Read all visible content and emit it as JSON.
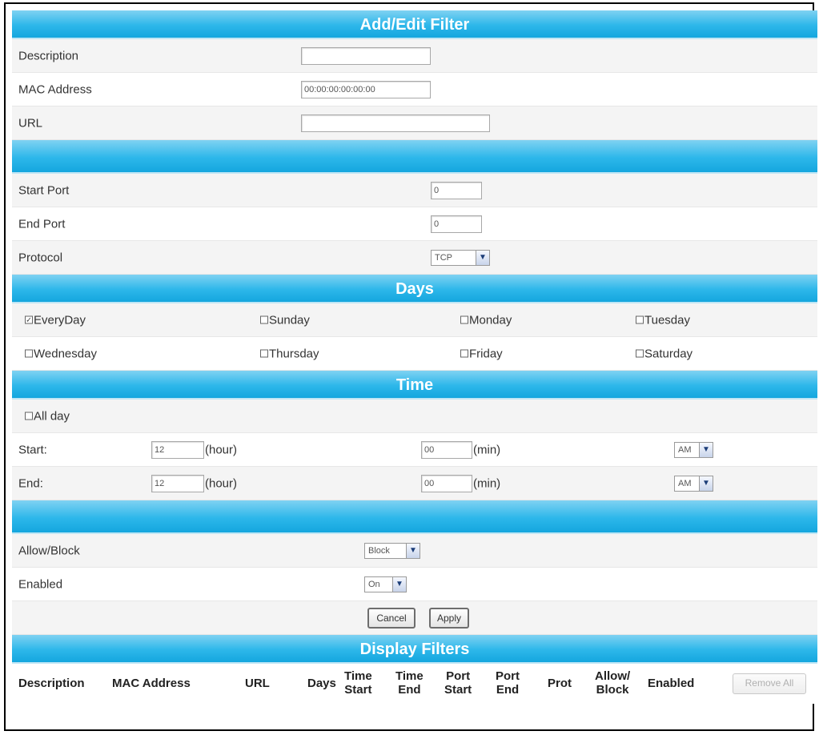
{
  "add_edit": {
    "title": "Add/Edit Filter",
    "description": {
      "label": "Description",
      "value": ""
    },
    "mac_address": {
      "label": "MAC Address",
      "value": "00:00:00:00:00:00"
    },
    "url": {
      "label": "URL",
      "value": ""
    },
    "start_port": {
      "label": "Start Port",
      "value": "0"
    },
    "end_port": {
      "label": "End Port",
      "value": "0"
    },
    "protocol": {
      "label": "Protocol",
      "value": "TCP"
    }
  },
  "days": {
    "title": "Days",
    "items": [
      {
        "label": "EveryDay",
        "checked": true
      },
      {
        "label": "Sunday",
        "checked": false
      },
      {
        "label": "Monday",
        "checked": false
      },
      {
        "label": "Tuesday",
        "checked": false
      },
      {
        "label": "Wednesday",
        "checked": false
      },
      {
        "label": "Thursday",
        "checked": false
      },
      {
        "label": "Friday",
        "checked": false
      },
      {
        "label": "Saturday",
        "checked": false
      }
    ]
  },
  "time": {
    "title": "Time",
    "all_day": {
      "label": "All day",
      "checked": false
    },
    "hour_unit": "(hour)",
    "min_unit": "(min)",
    "start": {
      "label": "Start:",
      "hour": "12",
      "min": "00",
      "ampm": "AM"
    },
    "end": {
      "label": "End:",
      "hour": "12",
      "min": "00",
      "ampm": "AM"
    }
  },
  "action": {
    "allow_block": {
      "label": "Allow/Block",
      "value": "Block"
    },
    "enabled": {
      "label": "Enabled",
      "value": "On"
    },
    "cancel": "Cancel",
    "apply": "Apply"
  },
  "display_filters": {
    "title": "Display Filters",
    "columns": {
      "description": "Description",
      "mac": "MAC Address",
      "url": "URL",
      "days": "Days",
      "time_start_1": "Time",
      "time_start_2": "Start",
      "time_end_1": "Time",
      "time_end_2": "End",
      "port_start_1": "Port",
      "port_start_2": "Start",
      "port_end_1": "Port",
      "port_end_2": "End",
      "prot": "Prot",
      "allow_block_1": "Allow/",
      "allow_block_2": "Block",
      "enabled": "Enabled"
    },
    "remove_all": "Remove All"
  },
  "icons": {
    "checked_glyph": "✓",
    "dropdown_glyph": "▼"
  }
}
